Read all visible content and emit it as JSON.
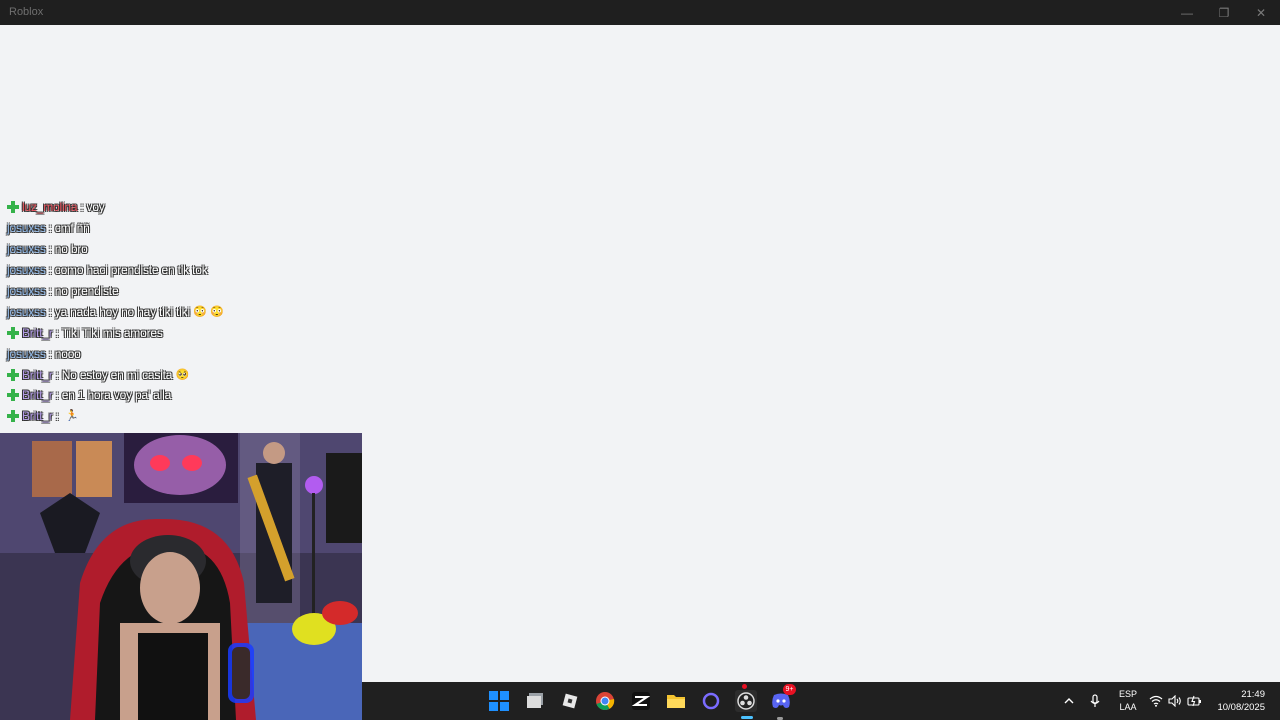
{
  "window": {
    "title": "Roblox",
    "minimize": "—",
    "restore": "❐",
    "close": "✕"
  },
  "chat": [
    {
      "badge": true,
      "user": "luz_molina",
      "color": "#e8505b",
      "text": "voy",
      "emojis": []
    },
    {
      "badge": false,
      "user": "josuxss",
      "color": "#8fb8e8",
      "text": "cmf ññ",
      "emojis": []
    },
    {
      "badge": false,
      "user": "josuxss",
      "color": "#8fb8e8",
      "text": "no bro",
      "emojis": []
    },
    {
      "badge": false,
      "user": "josuxss",
      "color": "#8fb8e8",
      "text": "como haci prendiste en tik tok",
      "emojis": []
    },
    {
      "badge": false,
      "user": "josuxss",
      "color": "#8fb8e8",
      "text": "no prendiste",
      "emojis": []
    },
    {
      "badge": false,
      "user": "josuxss",
      "color": "#8fb8e8",
      "text": "ya nada hoy no hay tiki tiki",
      "emojis": [
        "😳",
        "😳"
      ]
    },
    {
      "badge": true,
      "user": "Britt_r",
      "color": "#b39ce8",
      "text": "Tiki Tiki mis amores",
      "emojis": []
    },
    {
      "badge": false,
      "user": "josuxss",
      "color": "#8fb8e8",
      "text": "nooo",
      "emojis": []
    },
    {
      "badge": true,
      "user": "Britt_r",
      "color": "#b39ce8",
      "text": "No estoy en mi casita",
      "emojis": [
        "🥺"
      ]
    },
    {
      "badge": true,
      "user": "Britt_r",
      "color": "#b39ce8",
      "text": "en 1 hora voy pa' alla",
      "emojis": []
    },
    {
      "badge": true,
      "user": "Britt_r",
      "color": "#b39ce8",
      "text": "",
      "emojis": [
        "🏃"
      ]
    }
  ],
  "taskbar": {
    "apps": [
      {
        "name": "start-icon",
        "glyph": ""
      },
      {
        "name": "task-view-icon",
        "glyph": ""
      },
      {
        "name": "roblox-icon",
        "glyph": ""
      },
      {
        "name": "chrome-icon",
        "glyph": ""
      },
      {
        "name": "capcut-icon",
        "glyph": ""
      },
      {
        "name": "file-explorer-icon",
        "glyph": ""
      },
      {
        "name": "app-ring-icon",
        "glyph": ""
      },
      {
        "name": "obs-icon",
        "glyph": ""
      },
      {
        "name": "discord-icon",
        "glyph": ""
      }
    ],
    "discord_badge": "9+",
    "lang_top": "ESP",
    "lang_bottom": "LAA",
    "time": "21:49",
    "date": "10/08/2025"
  },
  "colors": {
    "accent": "#0078d4",
    "taskbar": "#202020",
    "background": "#f2f3f5"
  }
}
